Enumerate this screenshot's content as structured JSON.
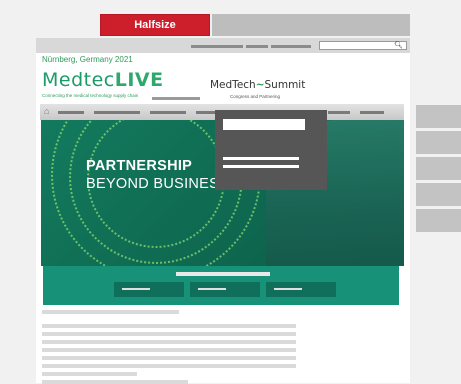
{
  "halfsize_tab": {
    "label": "Halfsize"
  },
  "header": {
    "location": "Nürnberg, Germany 2021",
    "logo_part1": "Medtec",
    "logo_part2": "LIVE",
    "tagline": "Connecting the medical technology supply chain",
    "summit_left": "MedTech",
    "summit_pulse": "~",
    "summit_right": "Summit",
    "summit_sub": "Congress and Partnering"
  },
  "nav": {
    "home_icon": "⌂"
  },
  "search": {
    "icon": "🔍︎"
  },
  "hero": {
    "line1": "PARTNERSHIP",
    "line2": "BEYOND BUSINESS"
  },
  "colors": {
    "accent_red": "#cc1f2b",
    "brand_green": "#1c9b6a",
    "hero_green": "#137a5e",
    "panel_green": "#179177"
  }
}
